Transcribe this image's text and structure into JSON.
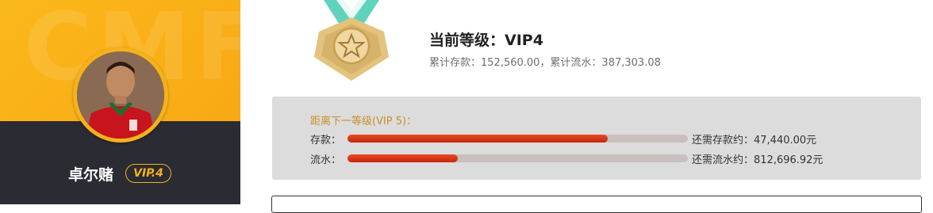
{
  "profile": {
    "background_text": "CMF",
    "username": "卓尔赌",
    "vip_badge": "VIP.4"
  },
  "level": {
    "title": "当前等级：VIP4",
    "summary": "累计存款：152,560.00，累计流水：387,303.08"
  },
  "progress": {
    "next_level_label": "距离下一等级(VIP 5)：",
    "deposit": {
      "label": "存款：",
      "fraction": 0.765,
      "remaining_text": "还需存款约：47,440.00元"
    },
    "turnover": {
      "label": "流水：",
      "fraction": 0.323,
      "remaining_text": "还需流水约：812,696.92元"
    }
  },
  "colors": {
    "brand_yellow": "#fbb81a",
    "dark_panel": "#2a2b33",
    "progress_red": "#d8320f",
    "medal_gold": "#e3c37e",
    "ribbon_teal": "#5fd3bb",
    "accent_text": "#c8902a"
  },
  "icons": {
    "medal": "medal-star-icon"
  }
}
